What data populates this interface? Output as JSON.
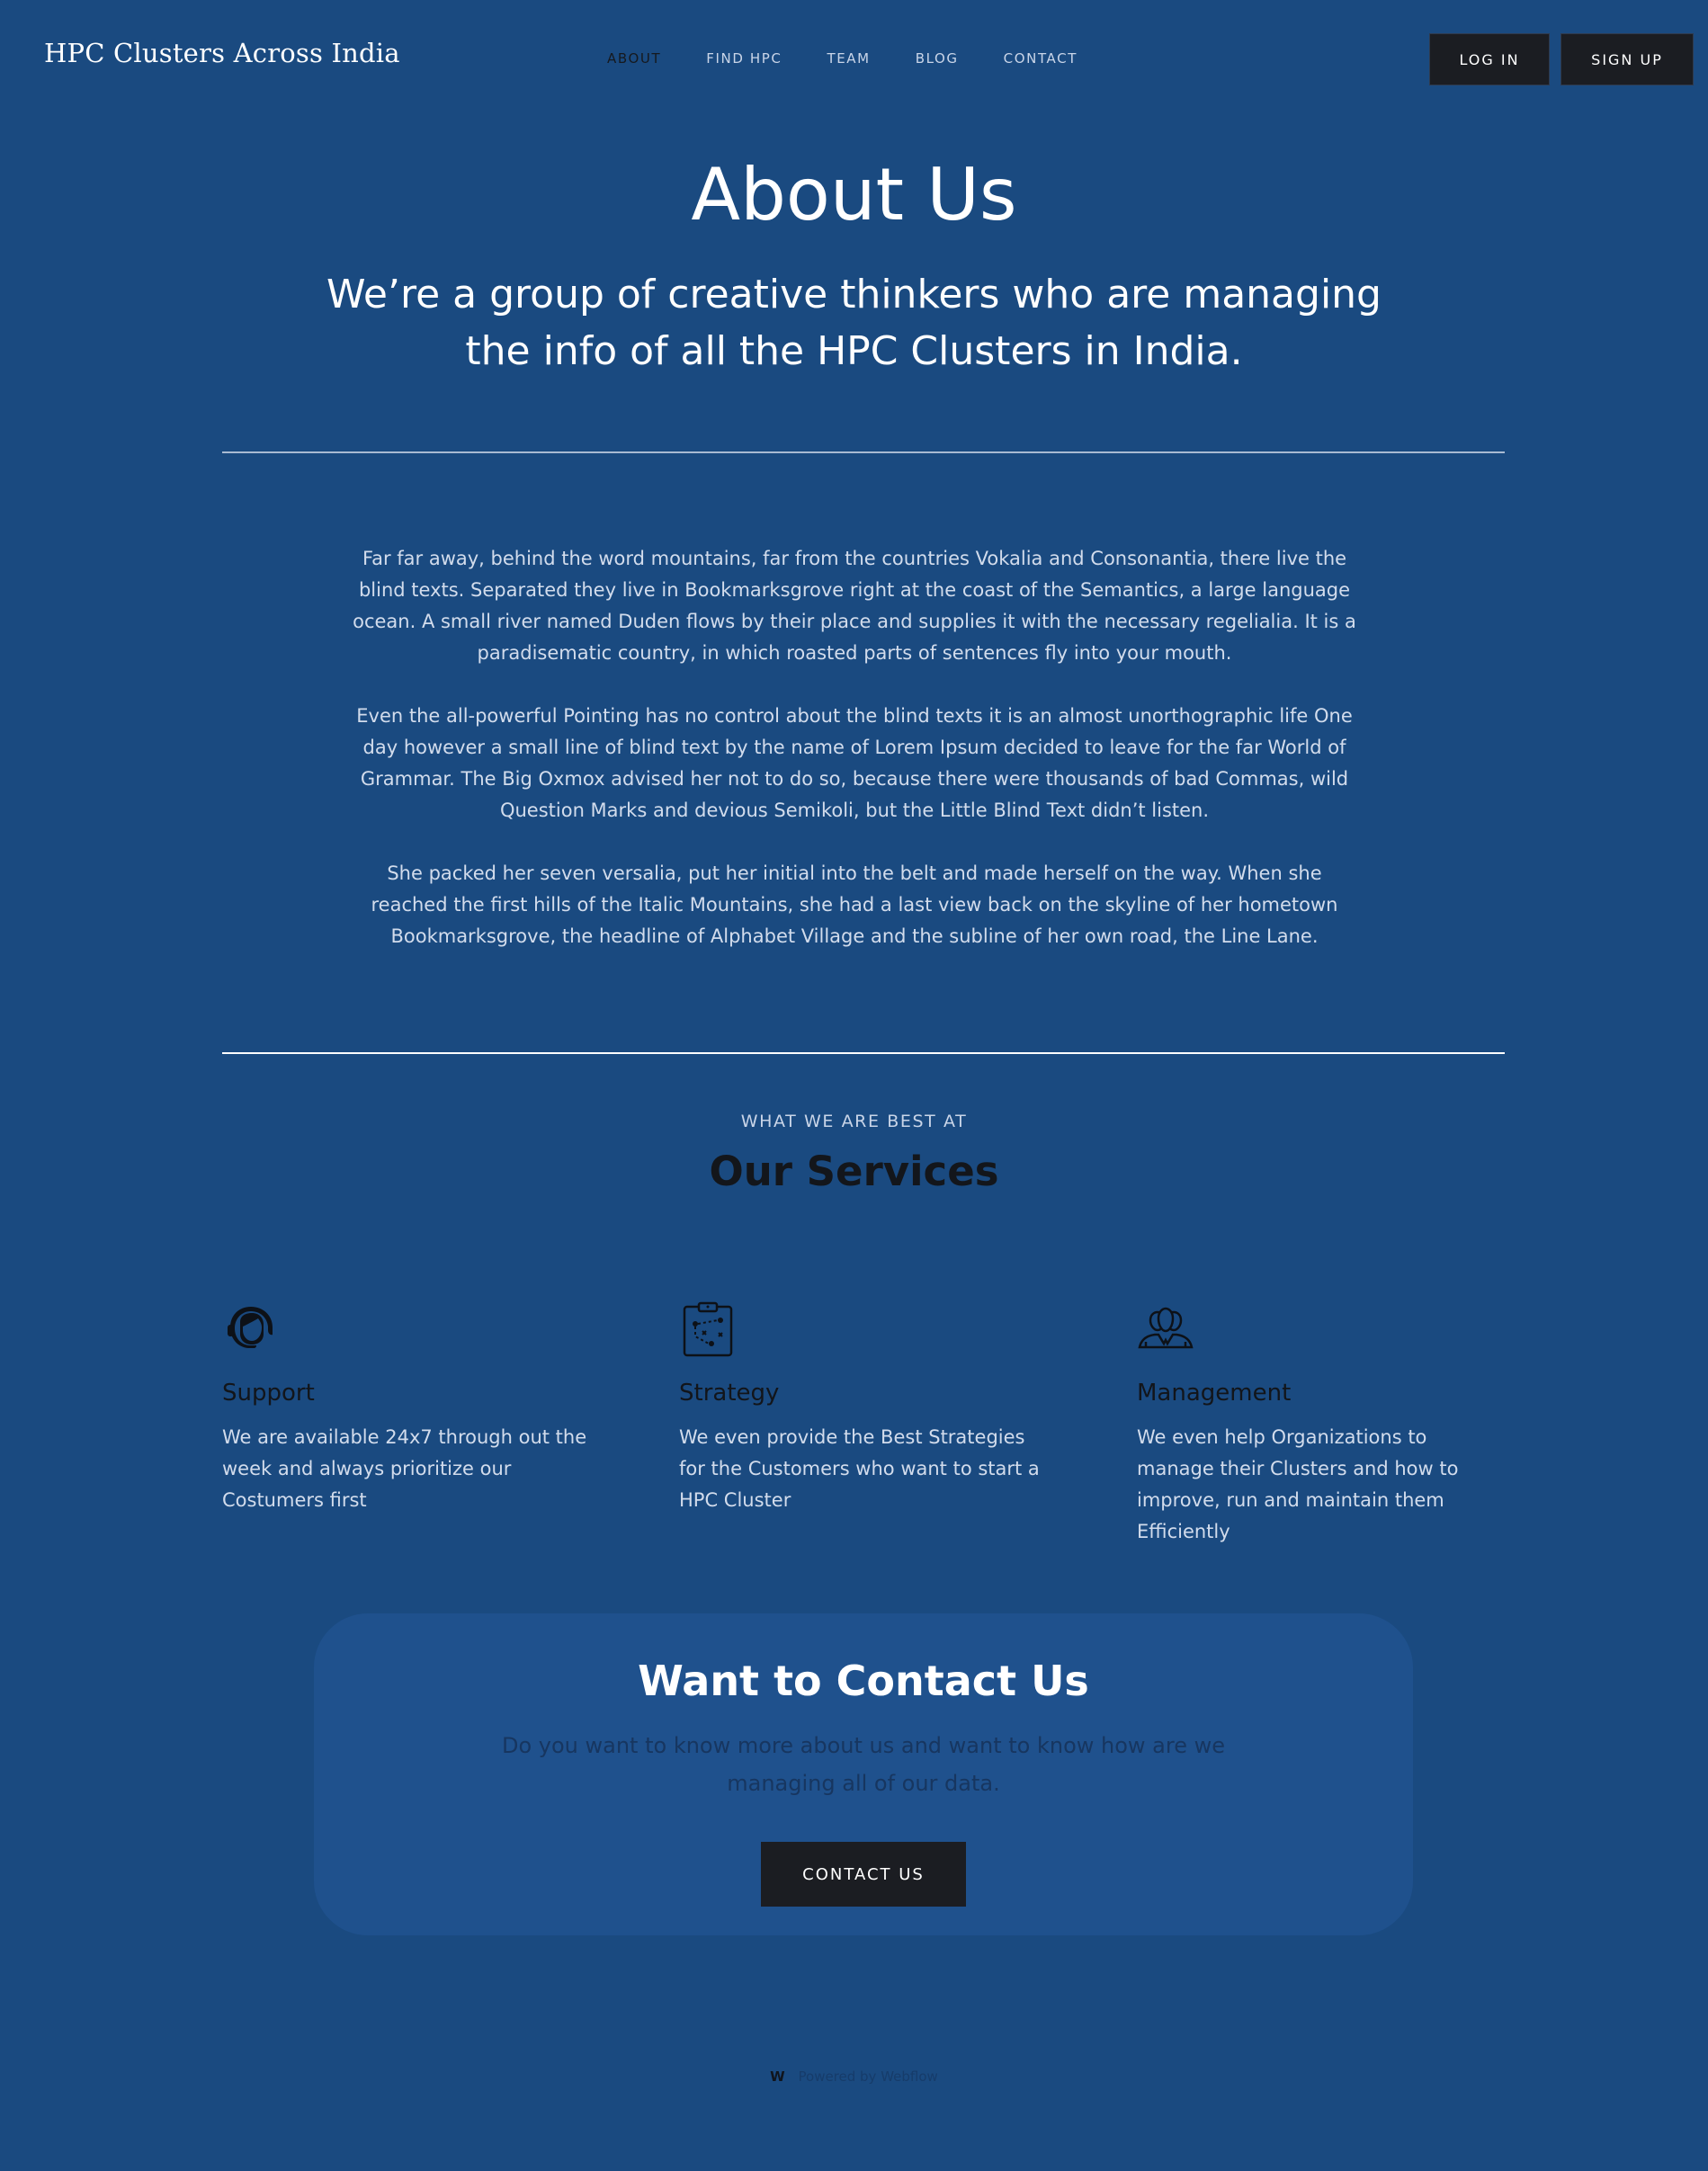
{
  "nav": {
    "brand": "HPC Clusters Across India",
    "links": [
      "ABOUT",
      "FIND HPC",
      "TEAM",
      "BLOG",
      "CONTACT"
    ],
    "active": "ABOUT",
    "login_label": "LOG IN",
    "signup_label": "SIGN UP"
  },
  "hero": {
    "title": "About Us",
    "subtitle": "We’re a group of creative thinkers who are managing the info of all the HPC Clusters in India."
  },
  "about": {
    "paragraphs": [
      "Far far away, behind the word mountains, far from the countries Vokalia and Consonantia, there live the blind texts. Separated they live in Bookmarksgrove right at the coast of the Semantics, a large language ocean. A small river named Duden flows by their place and supplies it with the necessary regelialia. It is a paradisematic country, in which roasted parts of sentences fly into your mouth.",
      "Even the all-powerful Pointing has no control about the blind texts it is an almost unorthographic life One day however a small line of blind text by the name of Lorem Ipsum decided to leave for the far World of Grammar. The Big Oxmox advised her not to do so, because there were thousands of bad Commas, wild Question Marks and devious Semikoli, but the Little Blind Text didn’t listen.",
      "She packed her seven versalia, put her initial into the belt and made herself on the way. When she reached the first hills of the Italic Mountains, she had a last view back on the skyline of her hometown Bookmarksgrove, the headline of Alphabet Village and the subline of her own road, the Line Lane."
    ]
  },
  "services": {
    "eyebrow": "WHAT WE ARE BEST AT",
    "title": "Our Services",
    "items": [
      {
        "icon": "headset-support-icon",
        "title": "Support",
        "description": "We are available 24x7 through out the week and always prioritize our Costumers first"
      },
      {
        "icon": "strategy-clipboard-icon",
        "title": "Strategy",
        "description": "We even provide the Best Strategies for the Customers who want to start a HPC Cluster"
      },
      {
        "icon": "team-management-icon",
        "title": "Management",
        "description": "We even help Organizations to manage their Clusters and how to improve, run and maintain them Efficiently"
      }
    ]
  },
  "contact": {
    "title": "Want to Contact Us",
    "description": "Do you want to know more about us and want to know how are we managing all of our data.",
    "button_label": "CONTACT US"
  },
  "footer": {
    "logo_glyph": "W",
    "powered_text": "Powered by Webflow"
  },
  "colors": {
    "background": "#1a4a80",
    "card": "#1f518d",
    "button": "#1b1d22",
    "text_light": "#d2dcec",
    "text_dark": "#13161b"
  }
}
